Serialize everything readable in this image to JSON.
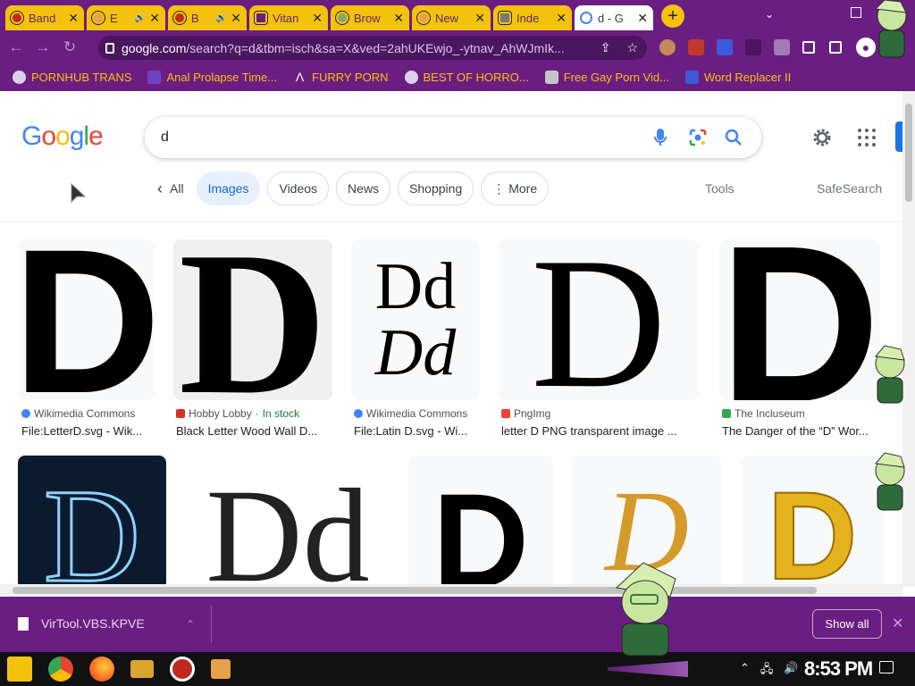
{
  "browser": {
    "tabs": [
      {
        "title": "Band"
      },
      {
        "title": "E"
      },
      {
        "title": "B"
      },
      {
        "title": "Vitan"
      },
      {
        "title": "Brow"
      },
      {
        "title": "New"
      },
      {
        "title": "Inde"
      },
      {
        "title": "d - G",
        "active": true
      }
    ],
    "new_tab_symbol": "+",
    "url_domain": "google.com",
    "url_path": "/search?q=d&tbm=isch&sa=X&ved=2ahUKEwjo_-ytnav_AhWJmIk...",
    "bookmarks": [
      {
        "label": "PORNHUB TRANS"
      },
      {
        "label": "Anal Prolapse Time..."
      },
      {
        "label": "FURRY PORN"
      },
      {
        "label": "BEST OF HORRO..."
      },
      {
        "label": "Free Gay Porn Vid..."
      },
      {
        "label": "Word Replacer II"
      }
    ],
    "accent_color": "#6b1e82",
    "tab_color": "#f4c20d"
  },
  "google": {
    "logo": "Google",
    "query": "d",
    "chips": {
      "back": "All",
      "images": "Images",
      "videos": "Videos",
      "news": "News",
      "shopping": "Shopping",
      "more": "More"
    },
    "tools": "Tools",
    "safesearch": "SafeSearch",
    "results": [
      {
        "source": "Wikimedia Commons",
        "caption": "File:LetterD.svg - Wik..."
      },
      {
        "source": "Hobby Lobby",
        "stock": "In stock",
        "caption": "Black Letter Wood Wall D..."
      },
      {
        "source": "Wikimedia Commons",
        "caption": "File:Latin D.svg - Wi...",
        "glyph_top": "Dd",
        "glyph_bottom": "Dd"
      },
      {
        "source": "PngImg",
        "caption": "letter D PNG transparent image ..."
      },
      {
        "source": "The Incluseum",
        "caption": "The Danger of the “D” Wor..."
      }
    ],
    "row2_glyphs": [
      "D",
      "Dd",
      "D",
      "D",
      "D"
    ]
  },
  "downloads": {
    "file": "VirTool.VBS.KPVE",
    "show_all": "Show all"
  },
  "taskbar": {
    "clock": "8:53 PM"
  }
}
